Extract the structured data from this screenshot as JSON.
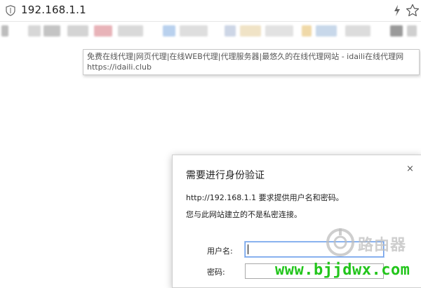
{
  "address_bar": {
    "url": "192.168.1.1",
    "icons": [
      "shield-icon",
      "bolt-icon",
      "star-icon"
    ]
  },
  "tooltip": {
    "title": "免费在线代理|网页代理|在线WEB代理|代理服务器|最悠久的在线代理网站 - idaili在线代理网",
    "url": "https://idaili.club"
  },
  "auth_dialog": {
    "title": "需要进行身份验证",
    "close_icon": "×",
    "message_line1": "http://192.168.1.1 要求提供用户名和密码。",
    "message_line2": "您与此网站建立的不是私密连接。",
    "username_label": "用户名:",
    "username_value": "",
    "password_label": "密码:",
    "password_value": ""
  },
  "watermark": {
    "logo_text": "路由器",
    "site": "www.bjjdwx.com",
    "site_color": "#22c51b"
  }
}
